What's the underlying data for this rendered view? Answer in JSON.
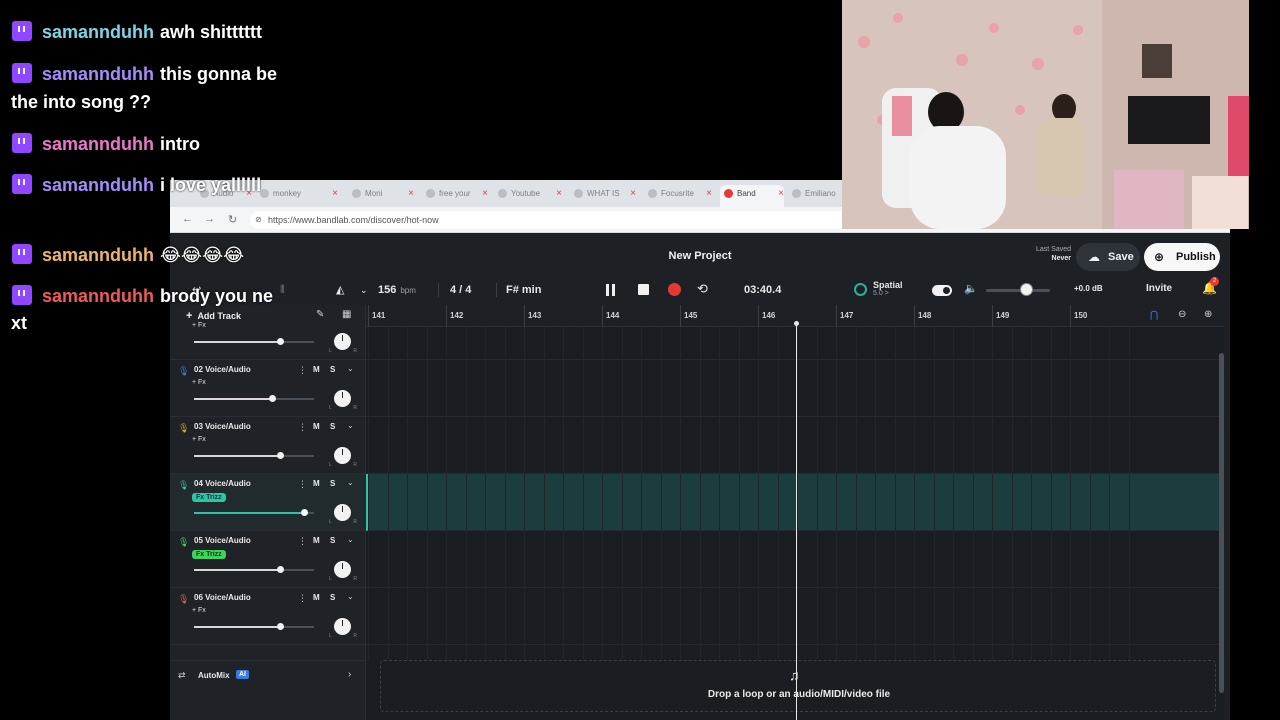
{
  "browser": {
    "tabs": [
      {
        "label": "Audio",
        "active": false
      },
      {
        "label": "monkey",
        "active": false
      },
      {
        "label": "Moni",
        "active": false
      },
      {
        "label": "free your",
        "active": false
      },
      {
        "label": "Youtube",
        "active": false
      },
      {
        "label": "WHAT IS",
        "active": false
      },
      {
        "label": "Focusrite",
        "active": false
      },
      {
        "label": "Band",
        "active": true
      },
      {
        "label": "Emiliano",
        "active": false
      }
    ],
    "url": "https://www.bandlab.com/discover/hot-now"
  },
  "daw": {
    "project_title": "New Project",
    "last_saved_label": "Last Saved",
    "last_saved_value": "Never",
    "save_label": "Save",
    "publish_label": "Publish",
    "bpm": "156",
    "bpm_unit": "bpm",
    "time_signature": "4 / 4",
    "key": "F# min",
    "time": "03:40.4",
    "spatial_label": "Spatial",
    "spatial_sub": "5.0 >",
    "volume_db": "+0.0 dB",
    "volume_level": 0.62,
    "invite_label": "Invite",
    "notification_count": "2",
    "add_track_label": "Add Track",
    "automix_label": "AutoMix",
    "ai_badge": "AI",
    "drop_text": "Drop a loop or an audio/MIDI/video file",
    "ruler_bars": [
      "141",
      "142",
      "143",
      "144",
      "145",
      "146",
      "147",
      "148",
      "149",
      "150"
    ],
    "tracks": [
      {
        "name": "",
        "fx": "+ Fx",
        "fx_chip": false,
        "volume": 0.72,
        "color": "#3a7de0"
      },
      {
        "name": "02  Voice/Audio",
        "fx": "+ Fx",
        "fx_chip": false,
        "volume": 0.65,
        "color": "#3a7de0"
      },
      {
        "name": "03  Voice/Audio",
        "fx": "+ Fx",
        "fx_chip": false,
        "volume": 0.72,
        "color": "#e0a23a"
      },
      {
        "name": "04  Voice/Audio",
        "fx": "Fx Trizz",
        "fx_chip": true,
        "volume": 0.92,
        "color": "#2ec4a8"
      },
      {
        "name": "05  Voice/Audio",
        "fx": "Fx Trizz",
        "fx_chip": true,
        "volume": 0.72,
        "color": "#3ed35c"
      },
      {
        "name": "06  Voice/Audio",
        "fx": "+ Fx",
        "fx_chip": false,
        "volume": 0.72,
        "color": "#e0633a"
      }
    ],
    "m_label": "M",
    "s_label": "S",
    "pan_l": "L",
    "pan_r": "R"
  },
  "chat": [
    {
      "user": "samannduhh",
      "user_color": "#7fd4e6",
      "message": "awh shitttttt"
    },
    {
      "user": "samannduhh",
      "user_color": "#a78bfa",
      "message": "this gonna be"
    },
    {
      "user": "",
      "user_color": "#ffffff",
      "message": "the into song ??"
    },
    {
      "user": "samannduhh",
      "user_color": "#e879c9",
      "message": "intro"
    },
    {
      "user": "samannduhh",
      "user_color": "#a78bfa",
      "message": "i love yallllll"
    },
    {
      "user": "",
      "user_color": "#ffffff",
      "message": "😂😂😂😂😂😂"
    },
    {
      "user": "samannduhh",
      "user_color": "#f0b36a",
      "message": "😂😂😂😂"
    },
    {
      "user": "samannduhh",
      "user_color": "#f05a5a",
      "message": "brody you ne"
    },
    {
      "user": "",
      "user_color": "#ffffff",
      "message": "xt"
    }
  ]
}
